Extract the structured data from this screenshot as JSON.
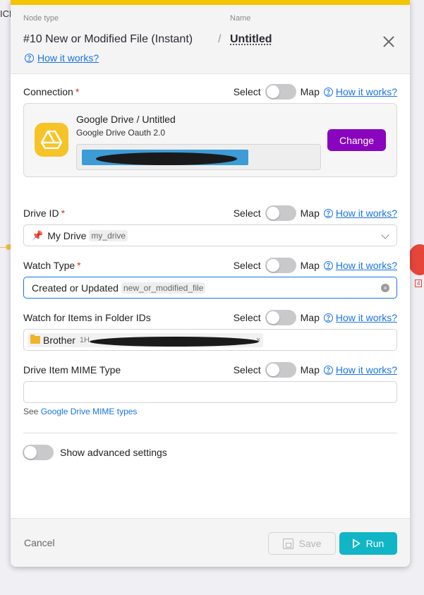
{
  "background": {
    "edge_text": "ICE"
  },
  "header": {
    "node_type_label": "Node type",
    "name_label": "Name",
    "node_title": "#10 New or Modified File (Instant)",
    "separator": "/",
    "node_name": "Untitled",
    "how_it_works": "How it works?"
  },
  "common": {
    "select_label": "Select",
    "map_label": "Map",
    "how_it_works": "How it works?",
    "required_mark": "*"
  },
  "connection": {
    "label": "Connection",
    "title": "Google Drive / Untitled",
    "subtitle": "Google Drive Oauth 2.0",
    "change_label": "Change"
  },
  "drive_id": {
    "label": "Drive ID",
    "value": "My Drive",
    "tag": "my_drive"
  },
  "watch_type": {
    "label": "Watch Type",
    "value": "Created or Updated",
    "tag": "new_or_modified_file"
  },
  "watch_folders": {
    "label": "Watch for Items in Folder IDs",
    "chip_label": "Brother",
    "chip_id_prefix": "1H",
    "chip_remove": "×"
  },
  "mime_type": {
    "label": "Drive Item MIME Type",
    "value": "",
    "hint_prefix": "See",
    "hint_link": "Google Drive MIME types"
  },
  "advanced": {
    "label": "Show advanced settings"
  },
  "footer": {
    "cancel_label": "Cancel",
    "save_label": "Save",
    "run_label": "Run"
  },
  "colors": {
    "accent_yellow": "#f5c400",
    "change_purple": "#8a05be",
    "run_teal": "#10b5c6",
    "link_blue": "#1a73e8",
    "required_red": "#d93025"
  }
}
